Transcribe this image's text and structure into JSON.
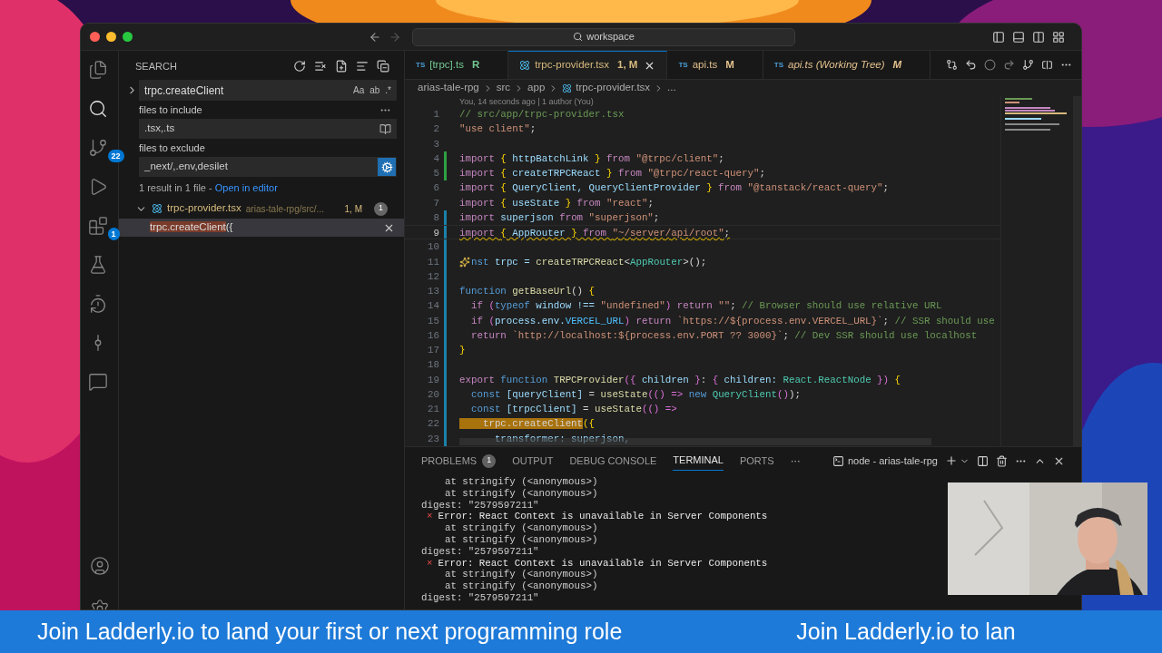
{
  "title_bar": {
    "search": "workspace"
  },
  "activity_bar": [
    {
      "selected": false
    },
    {
      "selected": true
    },
    {
      "selected": false,
      "badge": "22"
    },
    {
      "selected": false
    },
    {
      "selected": false,
      "badge": "1"
    },
    {
      "selected": false
    },
    {
      "selected": false
    },
    {
      "selected": false
    },
    {
      "selected": false
    }
  ],
  "sidebar": {
    "title": "SEARCH",
    "query": "trpc.createClient",
    "toggles": [
      "Aa",
      "ab",
      ".*"
    ],
    "include_label": "files to include",
    "include": ".tsx,.ts",
    "exclude_label": "files to exclude",
    "exclude": "_next/,.env,desilet",
    "summary": "1 result in 1 file - ",
    "summary_link": "Open in editor",
    "results": [
      {
        "file": "trpc-provider.tsx",
        "path": "arias-tale-rpg/src/...",
        "status": "1, M",
        "count": "1",
        "expanded": true,
        "matches": [
          {
            "match": "trpc.createClient",
            "rest": "({",
            "selected": true
          }
        ]
      }
    ]
  },
  "tabs": [
    {
      "kind": "ts",
      "icon_text": "TS",
      "label": "[trpc].ts",
      "status": "R",
      "color": "#73c991",
      "italic": false,
      "selected": false
    },
    {
      "kind": "react",
      "label": "trpc-provider.tsx",
      "status": "1, M",
      "color": "#d7ba7d",
      "italic": false,
      "selected": true
    },
    {
      "kind": "ts",
      "icon_text": "TS",
      "label": "api.ts",
      "status": "M",
      "color": "#e2c08d",
      "italic": false,
      "selected": false
    },
    {
      "kind": "ts",
      "icon_text": "TS",
      "label": "api.ts (Working Tree)",
      "status": "M",
      "color": "#e2c08d",
      "italic": true,
      "selected": false
    }
  ],
  "breadcrumb": [
    "arias-tale-rpg",
    "src",
    "app",
    "trpc-provider.tsx",
    "..."
  ],
  "blame": "You, 14 seconds ago | 1 author (You)",
  "code": [
    {
      "number": "1",
      "added": false,
      "modified": false,
      "warning": false,
      "sparkle": false,
      "tokens": [
        {
          "text": "// src/app/trpc-provider.tsx",
          "kind": "comment"
        }
      ]
    },
    {
      "number": "2",
      "added": false,
      "modified": false,
      "warning": false,
      "sparkle": false,
      "tokens": [
        {
          "text": "\"use client\"",
          "kind": "str"
        },
        {
          "text": ";",
          "kind": "plain"
        }
      ]
    },
    {
      "number": "3",
      "added": false,
      "modified": false
    },
    {
      "number": "4",
      "added": true,
      "modified": false,
      "warning": false,
      "sparkle": false,
      "tokens": [
        {
          "text": "import ",
          "kind": "kw"
        },
        {
          "text": "{",
          "kind": "brace"
        },
        {
          "text": " httpBatchLink ",
          "kind": "var"
        },
        {
          "text": "}",
          "kind": "brace"
        },
        {
          "text": " from ",
          "kind": "kw"
        },
        {
          "text": "\"@trpc/client\"",
          "kind": "str"
        },
        {
          "text": ";",
          "kind": "plain"
        }
      ]
    },
    {
      "number": "5",
      "added": true,
      "modified": false,
      "warning": false,
      "sparkle": false,
      "tokens": [
        {
          "text": "import ",
          "kind": "kw"
        },
        {
          "text": "{",
          "kind": "brace"
        },
        {
          "text": " createTRPCReact ",
          "kind": "var"
        },
        {
          "text": "}",
          "kind": "brace"
        },
        {
          "text": " from ",
          "kind": "kw"
        },
        {
          "text": "\"@trpc/react-query\"",
          "kind": "str"
        },
        {
          "text": ";",
          "kind": "plain"
        }
      ]
    },
    {
      "number": "6",
      "added": false,
      "modified": false,
      "warning": false,
      "sparkle": false,
      "tokens": [
        {
          "text": "import ",
          "kind": "kw"
        },
        {
          "text": "{",
          "kind": "brace"
        },
        {
          "text": " QueryClient, QueryClientProvider ",
          "kind": "var"
        },
        {
          "text": "}",
          "kind": "brace"
        },
        {
          "text": " from ",
          "kind": "kw"
        },
        {
          "text": "\"@tanstack/react-query\"",
          "kind": "str"
        },
        {
          "text": ";",
          "kind": "plain"
        }
      ]
    },
    {
      "number": "7",
      "added": false,
      "modified": false,
      "warning": false,
      "sparkle": false,
      "tokens": [
        {
          "text": "import ",
          "kind": "kw"
        },
        {
          "text": "{",
          "kind": "brace"
        },
        {
          "text": " useState ",
          "kind": "var"
        },
        {
          "text": "}",
          "kind": "brace"
        },
        {
          "text": " from ",
          "kind": "kw"
        },
        {
          "text": "\"react\"",
          "kind": "str"
        },
        {
          "text": ";",
          "kind": "plain"
        }
      ]
    },
    {
      "number": "8",
      "added": false,
      "modified": true,
      "warning": false,
      "sparkle": false,
      "tokens": [
        {
          "text": "import",
          "kind": "kw"
        },
        {
          "text": " superjson ",
          "kind": "var"
        },
        {
          "text": "from ",
          "kind": "kw"
        },
        {
          "text": "\"superjson\"",
          "kind": "str"
        },
        {
          "text": ";",
          "kind": "plain"
        }
      ]
    },
    {
      "number": "9",
      "added": false,
      "modified": true,
      "warning": true,
      "sparkle": false,
      "tokens": [
        {
          "text": "import ",
          "kind": "kw"
        },
        {
          "text": "{",
          "kind": "brace"
        },
        {
          "text": " AppRouter ",
          "kind": "var"
        },
        {
          "text": "}",
          "kind": "brace"
        },
        {
          "text": " from ",
          "kind": "kw"
        },
        {
          "text": "\"~/server/api/root\"",
          "kind": "str"
        },
        {
          "text": ";",
          "kind": "plain"
        }
      ]
    },
    {
      "number": "10",
      "added": false,
      "modified": true
    },
    {
      "number": "11",
      "added": false,
      "modified": true,
      "warning": false,
      "sparkle": true,
      "tokens": [
        {
          "text": "nst",
          "kind": "kw2"
        },
        {
          "text": " trpc = ",
          "kind": "var"
        },
        {
          "text": "createTRPCReact",
          "kind": "fn"
        },
        {
          "text": "<",
          "kind": "plain"
        },
        {
          "text": "AppRouter",
          "kind": "type"
        },
        {
          "text": ">();",
          "kind": "plain"
        }
      ]
    },
    {
      "number": "12",
      "added": false,
      "modified": true
    },
    {
      "number": "13",
      "added": false,
      "modified": true,
      "warning": false,
      "sparkle": false,
      "tokens": [
        {
          "text": "function",
          "kind": "kw2"
        },
        {
          "text": " getBaseUrl",
          "kind": "fn"
        },
        {
          "text": "() ",
          "kind": "plain"
        },
        {
          "text": "{",
          "kind": "brace"
        }
      ]
    },
    {
      "number": "14",
      "added": false,
      "modified": true,
      "warning": false,
      "sparkle": false,
      "tokens": [
        {
          "text": "  if ",
          "kind": "kw"
        },
        {
          "text": "(",
          "kind": "brace2"
        },
        {
          "text": "typeof",
          "kind": "kw2"
        },
        {
          "text": " window !== ",
          "kind": "var"
        },
        {
          "text": "\"undefined\"",
          "kind": "str"
        },
        {
          "text": ")",
          "kind": "brace2"
        },
        {
          "text": " return ",
          "kind": "kw"
        },
        {
          "text": "\"\"",
          "kind": "str"
        },
        {
          "text": "; ",
          "kind": "plain"
        },
        {
          "text": "// Browser should use relative URL",
          "kind": "comment"
        }
      ]
    },
    {
      "number": "15",
      "added": false,
      "modified": true,
      "warning": false,
      "sparkle": false,
      "tokens": [
        {
          "text": "  if ",
          "kind": "kw"
        },
        {
          "text": "(",
          "kind": "brace2"
        },
        {
          "text": "process.env.",
          "kind": "var"
        },
        {
          "text": "VERCEL_URL",
          "kind": "const"
        },
        {
          "text": ")",
          "kind": "brace2"
        },
        {
          "text": " return ",
          "kind": "kw"
        },
        {
          "text": "`https://${process.env.VERCEL_URL}`",
          "kind": "str"
        },
        {
          "text": "; ",
          "kind": "plain"
        },
        {
          "text": "// SSR should use",
          "kind": "comment"
        }
      ]
    },
    {
      "number": "16",
      "added": false,
      "modified": true,
      "warning": false,
      "sparkle": false,
      "tokens": [
        {
          "text": "  return ",
          "kind": "kw"
        },
        {
          "text": "`http://localhost:${process.env.PORT ?? 3000}`",
          "kind": "str"
        },
        {
          "text": "; ",
          "kind": "plain"
        },
        {
          "text": "// Dev SSR should use localhost",
          "kind": "comment"
        }
      ]
    },
    {
      "number": "17",
      "added": false,
      "modified": true,
      "warning": false,
      "sparkle": false,
      "tokens": [
        {
          "text": "}",
          "kind": "brace"
        }
      ]
    },
    {
      "number": "18",
      "added": false,
      "modified": true
    },
    {
      "number": "19",
      "added": false,
      "modified": true,
      "warning": false,
      "sparkle": false,
      "tokens": [
        {
          "text": "export ",
          "kind": "kw"
        },
        {
          "text": "function",
          "kind": "kw2"
        },
        {
          "text": " TRPCProvider",
          "kind": "fn"
        },
        {
          "text": "({",
          "kind": "brace2"
        },
        {
          "text": " children ",
          "kind": "var"
        },
        {
          "text": "}",
          "kind": "brace2"
        },
        {
          "text": ": ",
          "kind": "plain"
        },
        {
          "text": "{",
          "kind": "brace2"
        },
        {
          "text": " children: ",
          "kind": "var"
        },
        {
          "text": "React.ReactNode",
          "kind": "type"
        },
        {
          "text": " })",
          "kind": "brace2"
        },
        {
          "text": " {",
          "kind": "brace"
        }
      ]
    },
    {
      "number": "20",
      "added": false,
      "modified": true,
      "warning": false,
      "sparkle": false,
      "tokens": [
        {
          "text": "  const ",
          "kind": "kw2"
        },
        {
          "text": "[queryClient]",
          "kind": "var"
        },
        {
          "text": " = ",
          "kind": "plain"
        },
        {
          "text": "useState",
          "kind": "fn"
        },
        {
          "text": "(() => ",
          "kind": "brace2"
        },
        {
          "text": "new ",
          "kind": "kw2"
        },
        {
          "text": "QueryClient",
          "kind": "type"
        },
        {
          "text": "()",
          "kind": "brace2"
        },
        {
          "text": ");",
          "kind": "plain"
        }
      ]
    },
    {
      "number": "21",
      "added": false,
      "modified": true,
      "warning": false,
      "sparkle": false,
      "tokens": [
        {
          "text": "  const ",
          "kind": "kw2"
        },
        {
          "text": "[trpcClient]",
          "kind": "var"
        },
        {
          "text": " = ",
          "kind": "plain"
        },
        {
          "text": "useState",
          "kind": "fn"
        },
        {
          "text": "(() =>",
          "kind": "brace2"
        }
      ]
    },
    {
      "number": "22",
      "added": false,
      "modified": true,
      "warning": false,
      "sparkle": false,
      "tokens": [
        {
          "text": "    trpc.createClient",
          "kind": "match"
        },
        {
          "text": "({",
          "kind": "brace"
        }
      ]
    },
    {
      "number": "23",
      "added": false,
      "modified": true,
      "warning": false,
      "sparkle": false,
      "tokens": [
        {
          "text": "      transformer: superjson,",
          "kind": "var"
        }
      ]
    }
  ],
  "panel": {
    "tabs": [
      {
        "label": "PROBLEMS",
        "badge": "1",
        "selected": false
      },
      {
        "label": "OUTPUT",
        "selected": false
      },
      {
        "label": "DEBUG CONSOLE",
        "selected": false
      },
      {
        "label": "TERMINAL",
        "selected": true
      },
      {
        "label": "PORTS",
        "selected": false
      }
    ],
    "more": "···",
    "terminal_name": "node - arias-tale-rpg",
    "lines": [
      {
        "kind": "trace",
        "text": "    at stringify (<anonymous>)"
      },
      {
        "kind": "trace",
        "text": "    at stringify (<anonymous>)"
      },
      {
        "kind": "plain",
        "text": "digest: \"2579597211\""
      },
      {
        "kind": "error",
        "mark": "×",
        "text": "Error: React Context is unavailable in Server Components"
      },
      {
        "kind": "trace",
        "text": "    at stringify (<anonymous>)"
      },
      {
        "kind": "trace",
        "text": "    at stringify (<anonymous>)"
      },
      {
        "kind": "plain",
        "text": "digest: \"2579597211\""
      },
      {
        "kind": "error",
        "mark": "×",
        "text": "Error: React Context is unavailable in Server Components"
      },
      {
        "kind": "trace",
        "text": "    at stringify (<anonymous>)"
      },
      {
        "kind": "trace",
        "text": "    at stringify (<anonymous>)"
      },
      {
        "kind": "plain",
        "text": "digest: \"2579597211\""
      }
    ]
  },
  "webcam": {
    "kind": "picture"
  },
  "banner": [
    "Join Ladderly.io to land your first or next programming role",
    "Join Ladderly.io to lan"
  ]
}
